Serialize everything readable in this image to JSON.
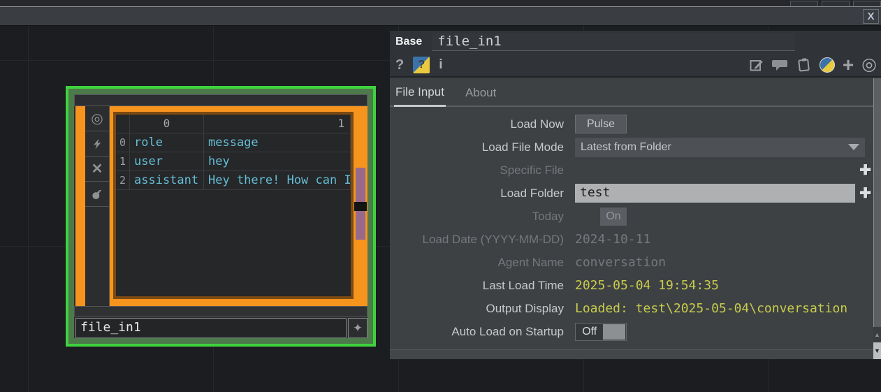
{
  "window": {
    "close": "X"
  },
  "network": {
    "node": {
      "name": "file_in1",
      "selected_border_color": "#3fd23f",
      "frame_color": "#f7941e",
      "table": {
        "col_headers": [
          "0",
          "1"
        ],
        "row_indices": [
          "0",
          "1",
          "2"
        ],
        "rows": [
          [
            "role",
            "message"
          ],
          [
            "user",
            "hey"
          ],
          [
            "assistant",
            "Hey there! How can I"
          ]
        ],
        "text_color": "#66bed6"
      },
      "name_field": "file_in1"
    }
  },
  "dialog": {
    "op_type": "Base",
    "op_name": "file_in1",
    "tabs": [
      {
        "label": "File Input",
        "active": true
      },
      {
        "label": "About",
        "active": false
      }
    ],
    "params": [
      {
        "label": "Load Now",
        "control": "pulse-button",
        "value": "Pulse",
        "enabled": true
      },
      {
        "label": "Load File Mode",
        "control": "dropdown",
        "value": "Latest from Folder",
        "enabled": true
      },
      {
        "label": "Specific File",
        "control": "file-picker",
        "value": "",
        "enabled": false
      },
      {
        "label": "Load Folder",
        "control": "file-picker-field",
        "value": "test",
        "enabled": true,
        "editing": true
      },
      {
        "label": "Today",
        "control": "toggle-button",
        "value": "On",
        "enabled": false
      },
      {
        "label": "Load Date (YYYY-MM-DD)",
        "control": "text",
        "value": "2024-10-11",
        "enabled": false
      },
      {
        "label": "Agent Name",
        "control": "text",
        "value": "conversation",
        "enabled": false
      },
      {
        "label": "Last Load Time",
        "control": "readout",
        "value": "2025-05-04 19:54:35",
        "enabled": true
      },
      {
        "label": "Output Display",
        "control": "readout",
        "value": "Loaded: test\\2025-05-04\\conversation",
        "enabled": true
      },
      {
        "label": "Auto Load on Startup",
        "control": "switch",
        "value": "Off",
        "enabled": true
      }
    ],
    "readout_color": "#c8cc4a"
  },
  "icons": {
    "help": "?",
    "python_help": "?",
    "info": "i",
    "add_parameter": "+",
    "target": "◎",
    "viewer_flag": "◎",
    "bypass_flag": "✕",
    "node_add": "✦",
    "file_browse": "✚",
    "scroll_up": "▲",
    "scroll_down": "▼"
  }
}
